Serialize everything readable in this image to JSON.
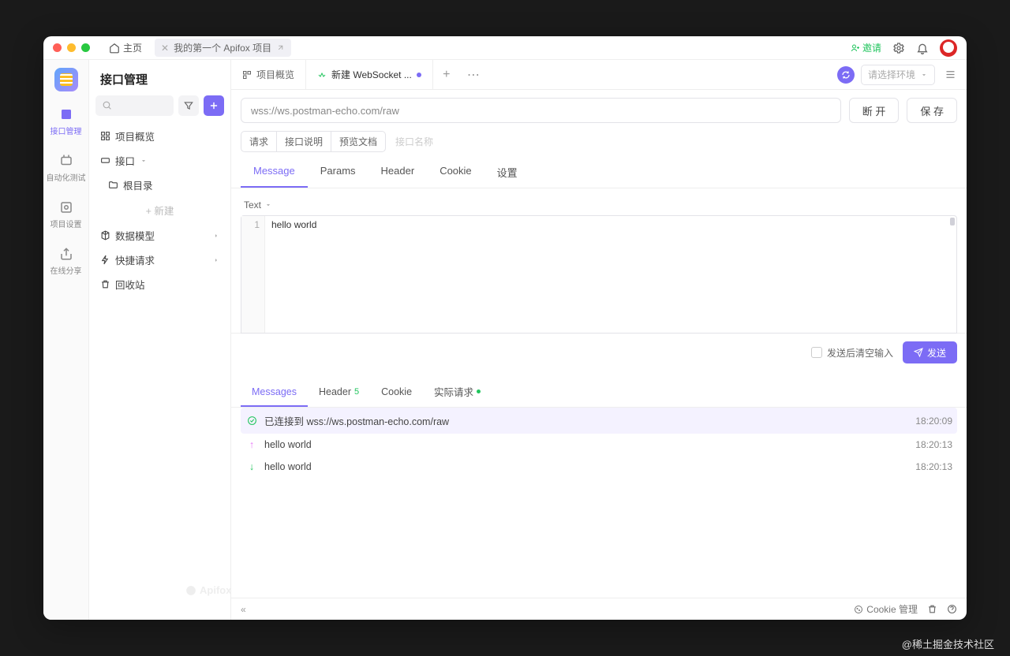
{
  "titlebar": {
    "home": "主页",
    "project_tab": "我的第一个 Apifox 项目",
    "invite": "邀请"
  },
  "rail": {
    "items": [
      "接口管理",
      "自动化测试",
      "项目设置",
      "在线分享"
    ]
  },
  "sidebar": {
    "title": "接口管理",
    "search_placeholder": "",
    "tree": {
      "overview": "项目概览",
      "apis": "接口",
      "root": "根目录",
      "new": "+ 新建",
      "models": "数据模型",
      "quick": "快捷请求",
      "trash": "回收站"
    }
  },
  "tabs": {
    "overview": "项目概览",
    "ws": "新建 WebSocket ...",
    "env_placeholder": "请选择环境"
  },
  "url": {
    "value": "wss://ws.postman-echo.com/raw",
    "disconnect": "断 开",
    "save": "保 存"
  },
  "seg": {
    "req": "请求",
    "desc": "接口说明",
    "preview": "预览文档",
    "name_ph": "接口名称"
  },
  "req_tabs": [
    "Message",
    "Params",
    "Header",
    "Cookie",
    "设置"
  ],
  "msg": {
    "type": "Text",
    "line_no": "1",
    "content": "hello world"
  },
  "footer": {
    "clear": "发送后清空输入",
    "send": "发送"
  },
  "resp_tabs": {
    "messages": "Messages",
    "header": "Header",
    "header_count": "5",
    "cookie": "Cookie",
    "actual": "实际请求"
  },
  "log": {
    "connected": "已连接到 wss://ws.postman-echo.com/raw",
    "rows": [
      {
        "dir": "up",
        "text": "hello world",
        "time": "18:20:13"
      },
      {
        "dir": "down",
        "text": "hello world",
        "time": "18:20:13"
      }
    ],
    "connected_time": "18:20:09"
  },
  "status": {
    "cookie": "Cookie 管理"
  },
  "brand": "Apifox",
  "watermark": "@稀土掘金技术社区"
}
